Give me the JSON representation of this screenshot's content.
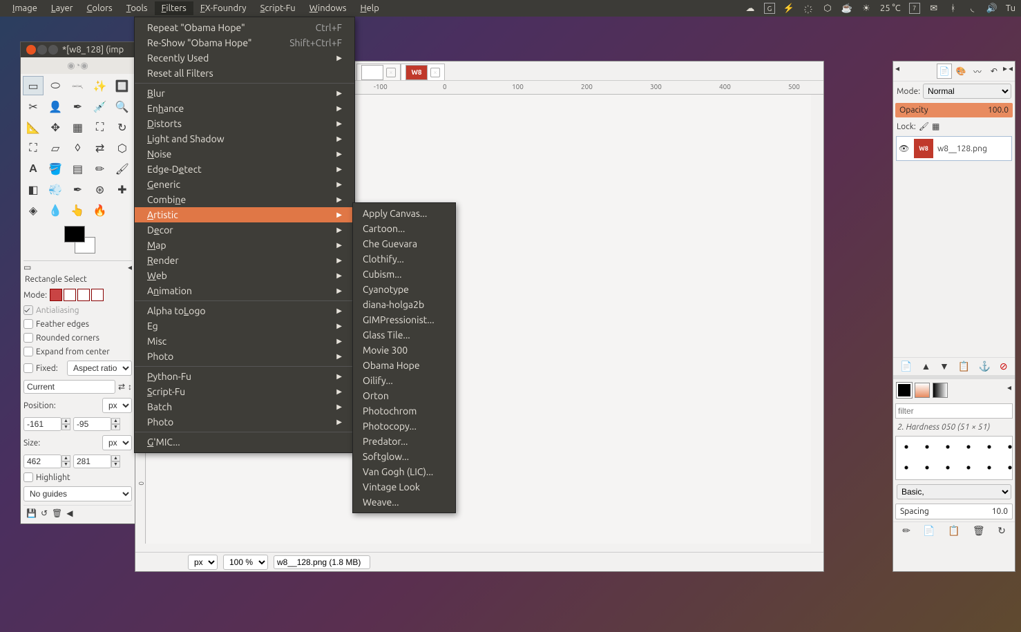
{
  "systemMenu": [
    "Image",
    "Layer",
    "Colors",
    "Tools",
    "Filters",
    "FX-Foundry",
    "Script-Fu",
    "Windows",
    "Help"
  ],
  "systemTray": {
    "temp": "25 °C",
    "day": "7",
    "time": "Tu"
  },
  "toolbox": {
    "title": "*[w8_128] (imp",
    "toolOptionsTitle": "Rectangle Select",
    "modeLabel": "Mode:",
    "antialiasing": "Antialiasing",
    "feather": "Feather edges",
    "rounded": "Rounded corners",
    "expand": "Expand from center",
    "fixedLabel": "Fixed:",
    "fixedValue": "Aspect ratio",
    "currentValue": "Current",
    "positionLabel": "Position:",
    "posUnit": "px",
    "posX": "-161",
    "posY": "-95",
    "sizeLabel": "Size:",
    "sizeUnit": "px",
    "sizeW": "462",
    "sizeH": "281",
    "highlight": "Highlight",
    "noGuides": "No guides"
  },
  "canvas": {
    "redText": "W8",
    "rulerTicks": [
      "-100",
      "0",
      "100",
      "200",
      "300",
      "400",
      "500"
    ],
    "rulerVTicks": [
      "0"
    ],
    "statusUnit": "px",
    "zoom": "100 %",
    "filename": "w8__128.png (1.8 MB)",
    "tabs": [
      {
        "red": false,
        "text": ""
      },
      {
        "red": true,
        "text": "W8"
      }
    ]
  },
  "rightPanel": {
    "modeLabel": "Mode:",
    "modeValue": "Normal",
    "opacityLabel": "Opacity",
    "opacityValue": "100.0",
    "lockLabel": "Lock:",
    "layerName": "w8__128.png",
    "filterPlaceholder": "filter",
    "hardness": "2. Hardness 050 (51 × 51)",
    "basicSelect": "Basic,",
    "spacingLabel": "Spacing",
    "spacingValue": "10.0"
  },
  "filterMenu": {
    "group1": [
      {
        "label": "Repeat \"Obama Hope\"",
        "shortcut": "Ctrl+F"
      },
      {
        "label": "Re-Show \"Obama Hope\"",
        "shortcut": "Shift+Ctrl+F"
      },
      {
        "label": "Recently Used",
        "sub": true
      },
      {
        "label": "Reset all Filters"
      }
    ],
    "group2": [
      {
        "label": "Blur",
        "u": 0,
        "sub": true
      },
      {
        "label": "Enhance",
        "u": 2,
        "sub": true
      },
      {
        "label": "Distorts",
        "u": 0,
        "sub": true
      },
      {
        "label": "Light and Shadow",
        "u": 0,
        "sub": true
      },
      {
        "label": "Noise",
        "u": 0,
        "sub": true
      },
      {
        "label": "Edge-Detect",
        "u": 6,
        "sub": true
      },
      {
        "label": "Generic",
        "u": 0,
        "sub": true
      },
      {
        "label": "Combine",
        "u": 5,
        "sub": true
      },
      {
        "label": "Artistic",
        "u": 0,
        "sub": true,
        "hover": true
      },
      {
        "label": "Decor",
        "u": 1,
        "sub": true
      },
      {
        "label": "Map",
        "u": 0,
        "sub": true
      },
      {
        "label": "Render",
        "u": 0,
        "sub": true
      },
      {
        "label": "Web",
        "u": 0,
        "sub": true
      },
      {
        "label": "Animation",
        "u": 1,
        "sub": true
      }
    ],
    "group3": [
      {
        "label": "Alpha to Logo",
        "u": 9,
        "sub": true
      },
      {
        "label": "Eg",
        "sub": true
      },
      {
        "label": "Misc",
        "sub": true
      },
      {
        "label": "Photo",
        "sub": true
      }
    ],
    "group4": [
      {
        "label": "Python-Fu",
        "u": 0,
        "sub": true
      },
      {
        "label": "Script-Fu",
        "u": 0,
        "sub": true
      },
      {
        "label": "Batch",
        "sub": true
      },
      {
        "label": "Photo",
        "sub": true
      }
    ],
    "group5": [
      {
        "label": "G'MIC...",
        "u": 0
      }
    ]
  },
  "artisticSubmenu": [
    "Apply Canvas...",
    "Cartoon...",
    "Che Guevara",
    "Clothify...",
    "Cubism...",
    "Cyanotype",
    "diana-holga2b",
    "GIMPressionist...",
    "Glass Tile...",
    "Movie 300",
    "Obama Hope",
    "Oilify...",
    "Orton",
    "Photochrom",
    "Photocopy...",
    "Predator...",
    "Softglow...",
    "Van Gogh (LIC)...",
    "Vintage Look",
    "Weave..."
  ]
}
